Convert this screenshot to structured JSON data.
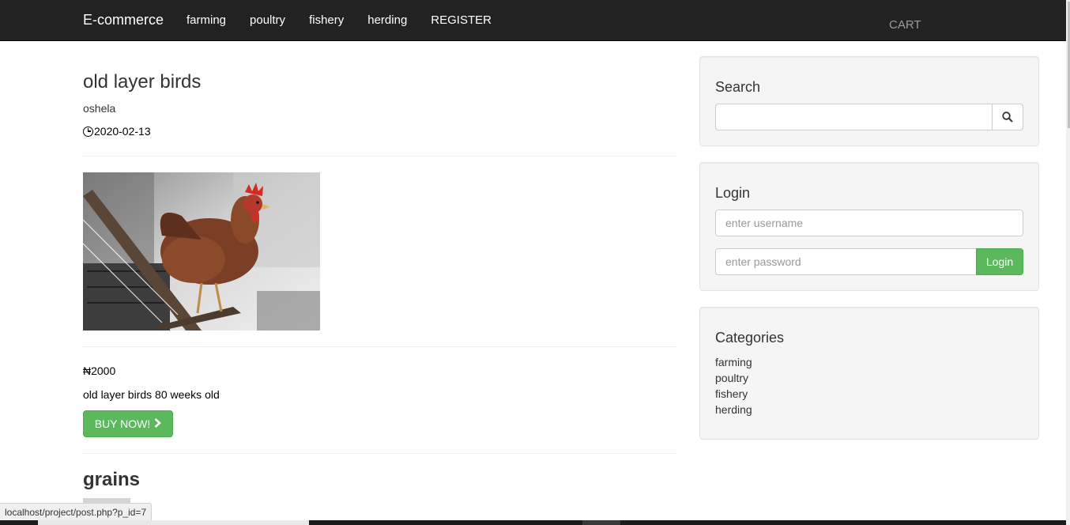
{
  "navbar": {
    "brand": "E-commerce",
    "links": [
      "farming",
      "poultry",
      "fishery",
      "herding",
      "REGISTER"
    ],
    "cart": "CART"
  },
  "post": {
    "title": "old layer birds",
    "author": "oshela",
    "date": "2020-02-13",
    "image_alt": "rooster",
    "price": "₦2000",
    "description": "old layer birds 80 weeks old",
    "buy_label": "BUY NOW!"
  },
  "next_post": {
    "title": "grains"
  },
  "sidebar": {
    "search": {
      "title": "Search",
      "value": ""
    },
    "login": {
      "title": "Login",
      "username_placeholder": "enter username",
      "password_placeholder": "enter password",
      "button": "Login"
    },
    "categories": {
      "title": "Categories",
      "items": [
        "farming",
        "poultry",
        "fishery",
        "herding"
      ]
    }
  },
  "status_bar": "localhost/project/post.php?p_id=7",
  "colors": {
    "navbar_bg": "#222222",
    "success": "#5cb85c",
    "well_bg": "#f5f5f5"
  }
}
